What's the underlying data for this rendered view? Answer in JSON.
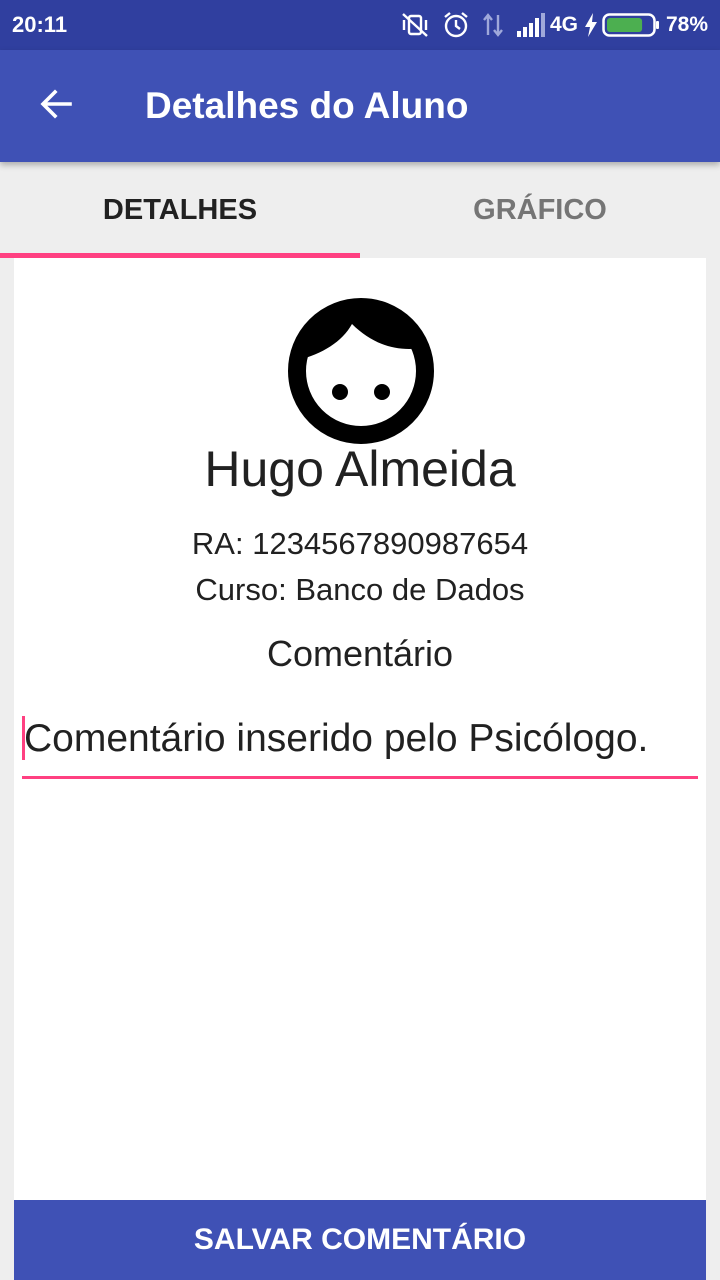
{
  "status_bar": {
    "time": "20:11",
    "network": "4G",
    "battery_percent": "78%",
    "battery_level": 0.78,
    "icons": [
      "vibrate-off-icon",
      "alarm-icon",
      "data-arrows-icon",
      "signal-icon",
      "charging-icon",
      "battery-icon"
    ]
  },
  "app_bar": {
    "title": "Detalhes do Aluno",
    "back_icon": "arrow-back-icon"
  },
  "tabs": [
    {
      "label": "DETALHES",
      "active": true
    },
    {
      "label": "GRÁFICO",
      "active": false
    }
  ],
  "student": {
    "avatar_icon": "face-icon",
    "name": "Hugo Almeida",
    "ra": "RA: 1234567890987654",
    "course": "Curso: Banco de Dados"
  },
  "comment": {
    "label": "Comentário",
    "value": "Comentário inserido pelo Psicólogo."
  },
  "actions": {
    "save_label": "SALVAR COMENTÁRIO"
  },
  "colors": {
    "primary": "#3f51b5",
    "primary_dark": "#303f9f",
    "accent": "#ff4081",
    "battery_fill": "#4caf50"
  }
}
